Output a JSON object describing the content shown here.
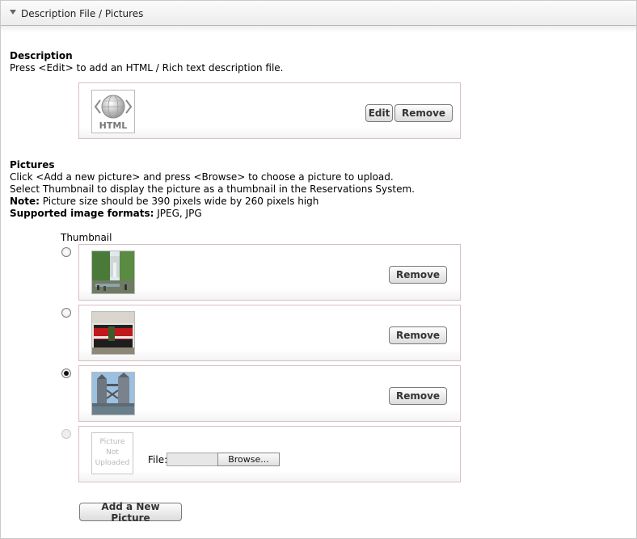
{
  "panel": {
    "title": "Description File / Pictures"
  },
  "description": {
    "heading": "Description",
    "help": "Press <Edit> to add an HTML / Rich text description file.",
    "icon_label": "HTML",
    "edit_label": "Edit",
    "remove_label": "Remove"
  },
  "pictures": {
    "heading": "Pictures",
    "help_lines": [
      "Click <Add a new picture> and press <Browse> to choose a picture to upload.",
      "Select Thumbnail to display the picture as a thumbnail in the Reservations System."
    ],
    "note_label": "Note:",
    "note_text": " Picture size should be 390 pixels wide by 260 pixels high",
    "formats_label": "Supported image formats:",
    "formats_text": " JPEG, JPG",
    "thumbnail_label": "Thumbnail",
    "items": [
      {
        "thumbnail_selected": false,
        "remove_label": "Remove"
      },
      {
        "thumbnail_selected": false,
        "remove_label": "Remove"
      },
      {
        "thumbnail_selected": true,
        "remove_label": "Remove"
      }
    ],
    "new_item": {
      "placeholder_lines": [
        "Picture",
        "Not",
        "Uploaded"
      ],
      "file_label": "File:",
      "file_value": "",
      "browse_label": "Browse..."
    },
    "add_label": "Add a New Picture"
  },
  "colors": {
    "box_border": "#d7bfc3",
    "header_bg": "#ececec"
  }
}
